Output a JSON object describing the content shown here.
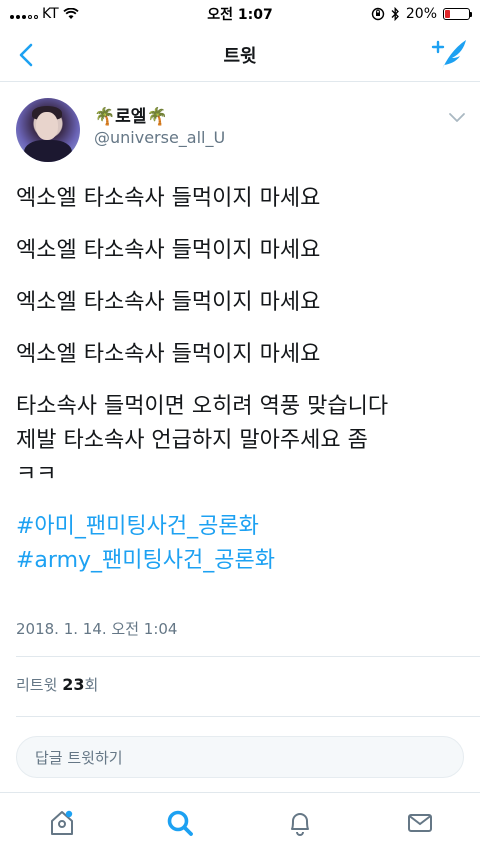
{
  "status_bar": {
    "carrier": "KT",
    "time": "오전 1:07",
    "battery_percent": "20%",
    "battery_level": 0.2,
    "battery_color": "#e0272b"
  },
  "nav": {
    "title": "트윗",
    "back_icon": "chevron-left-icon",
    "compose_icon": "compose-tweet-icon"
  },
  "tweet": {
    "display_name": "🌴로엘🌴",
    "username": "@universe_all_U",
    "lines": [
      "엑소엘 타소속사 들먹이지 마세요",
      "엑소엘 타소속사 들먹이지 마세요",
      "엑소엘 타소속사 들먹이지 마세요",
      "엑소엘 타소속사 들먹이지 마세요",
      "타소속사 들먹이면 오히려 역풍 맞습니다",
      "제발 타소속사 언급하지 말아주세요 좀",
      "ㅋㅋ"
    ],
    "hashtags": [
      "#아미_팬미팅사건_공론화",
      "#army_팬미팅사건_공론화"
    ],
    "timestamp": "2018. 1. 14. 오전 1:04"
  },
  "stats": {
    "retweet_label": "리트윗",
    "retweet_count": "23",
    "retweet_unit": "회"
  },
  "reply": {
    "placeholder": "답글 트윗하기"
  },
  "tab_bar": {
    "tabs": [
      "home-icon",
      "search-icon",
      "notifications-icon",
      "messages-icon"
    ]
  },
  "colors": {
    "accent": "#1da1f2",
    "secondary_text": "#657786"
  }
}
